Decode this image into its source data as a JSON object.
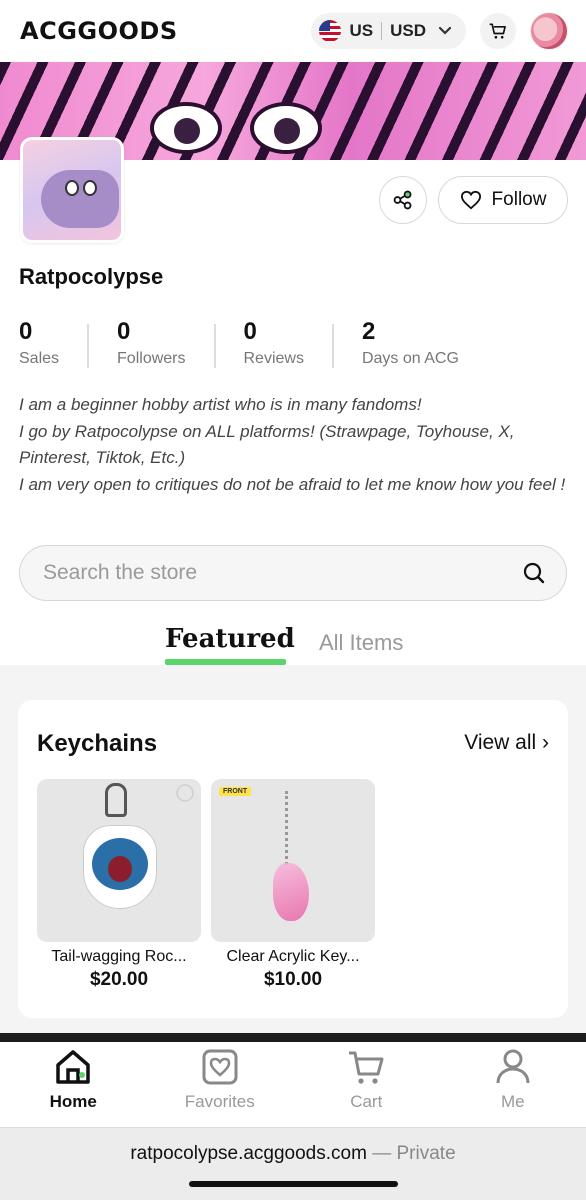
{
  "header": {
    "logo": "ACGGOODS",
    "region": "US",
    "currency": "USD",
    "icons": [
      "us-flag-icon",
      "chevron-down-icon",
      "cart-icon",
      "avatar"
    ]
  },
  "profile": {
    "store_name": "Ratpocolypse",
    "follow_label": "Follow",
    "stats": [
      {
        "value": "0",
        "label": "Sales"
      },
      {
        "value": "0",
        "label": "Followers"
      },
      {
        "value": "0",
        "label": "Reviews"
      },
      {
        "value": "2",
        "label": "Days on ACG"
      }
    ],
    "bio": [
      "I am a beginner hobby artist who is in many fandoms!",
      "I go by Ratpocolypse on ALL platforms! (Strawpage, Toyhouse, X, Pinterest, Tiktok, Etc.)",
      "I am very open to critiques do not be afraid to let me know how you feel !"
    ]
  },
  "search": {
    "placeholder": "Search the store"
  },
  "tabs": {
    "featured": "Featured",
    "all_items": "All Items"
  },
  "section": {
    "title": "Keychains",
    "view_all": "View all ›",
    "products": [
      {
        "name": "Tail-wagging Roc...",
        "price": "$20.00"
      },
      {
        "name": "Clear Acrylic Key...",
        "price": "$10.00",
        "tag": "FRONT"
      }
    ]
  },
  "bottom_nav": [
    {
      "label": "Home",
      "active": true
    },
    {
      "label": "Favorites",
      "active": false
    },
    {
      "label": "Cart",
      "active": false
    },
    {
      "label": "Me",
      "active": false
    }
  ],
  "browser": {
    "url": "ratpocolypse.acggoods.com",
    "private_label": "— Private"
  },
  "colors": {
    "accent_green": "#5bd46b",
    "text_dark": "#111111",
    "muted": "#999999"
  }
}
